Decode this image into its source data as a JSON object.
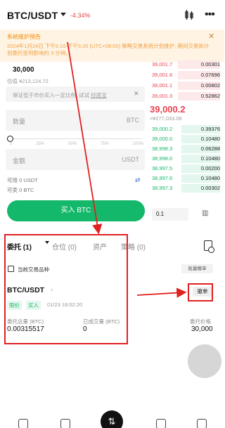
{
  "header": {
    "symbol": "BTC/USDT",
    "change": "-4.34%"
  },
  "notice": {
    "title": "系统维护预告",
    "body": "2024年1月24日 下午5:10-下午5:20 (UTC+08:00) 策略交易系统计划维护, 期间交易和计划委托受到影响约 3 分钟。"
  },
  "form": {
    "price": "30,000",
    "estimate": "估值 ¥213,124.72",
    "tip": "保证低于市价买入一定比例, 试试",
    "tip_link": "抄底宝",
    "amount_placeholder": "数量",
    "amount_unit": "BTC",
    "pcts": [
      "0",
      "25%",
      "50%",
      "75%",
      "100%"
    ],
    "total_placeholder": "金额",
    "total_unit": "USDT",
    "avail_usdt": "可用  0 USDT",
    "avail_btc": "可卖  0 BTC",
    "buy_label": "买入 BTC"
  },
  "orderbook": {
    "asks": [
      {
        "p": "39,001.7",
        "q": "0.00301"
      },
      {
        "p": "39,001.6",
        "q": "0.07696"
      },
      {
        "p": "39,001.1",
        "q": "0.00802"
      },
      {
        "p": "39,001.3",
        "q": "0.52862"
      }
    ],
    "mid": "39,000.2",
    "mid_cny": "≈¥277,033.06",
    "bids": [
      {
        "p": "39,000.2",
        "q": "0.39376"
      },
      {
        "p": "39,000.0",
        "q": "0.10480"
      },
      {
        "p": "38,998.3",
        "q": "0.06288"
      },
      {
        "p": "38,998.0",
        "q": "0.10480"
      },
      {
        "p": "38,997.5",
        "q": "0.00200"
      },
      {
        "p": "38,997.6",
        "q": "0.10480"
      },
      {
        "p": "38,997.3",
        "q": "0.00302"
      }
    ],
    "depth": "0.1"
  },
  "tabs": {
    "orders": "委托 (1)",
    "positions": "仓位 (0)",
    "assets": "资产",
    "strategy": "策略 (0)"
  },
  "filter": {
    "current_only": "当前交易品种",
    "batch_cancel": "批量撤单"
  },
  "order": {
    "symbol": "BTC/USDT",
    "type": "限价",
    "side": "买入",
    "time": "01/23 18:02:20",
    "cancel_label": "撤单",
    "qty_label": "委托总量 (BTC)",
    "qty_value": "0.00315517",
    "filled_label": "已成交量 (BTC)",
    "filled_value": "0",
    "price_label": "委托价格",
    "price_value": "30,000"
  },
  "colors": {
    "up": "#14b86a",
    "down": "#e8424f",
    "annotation": "#e12020"
  }
}
